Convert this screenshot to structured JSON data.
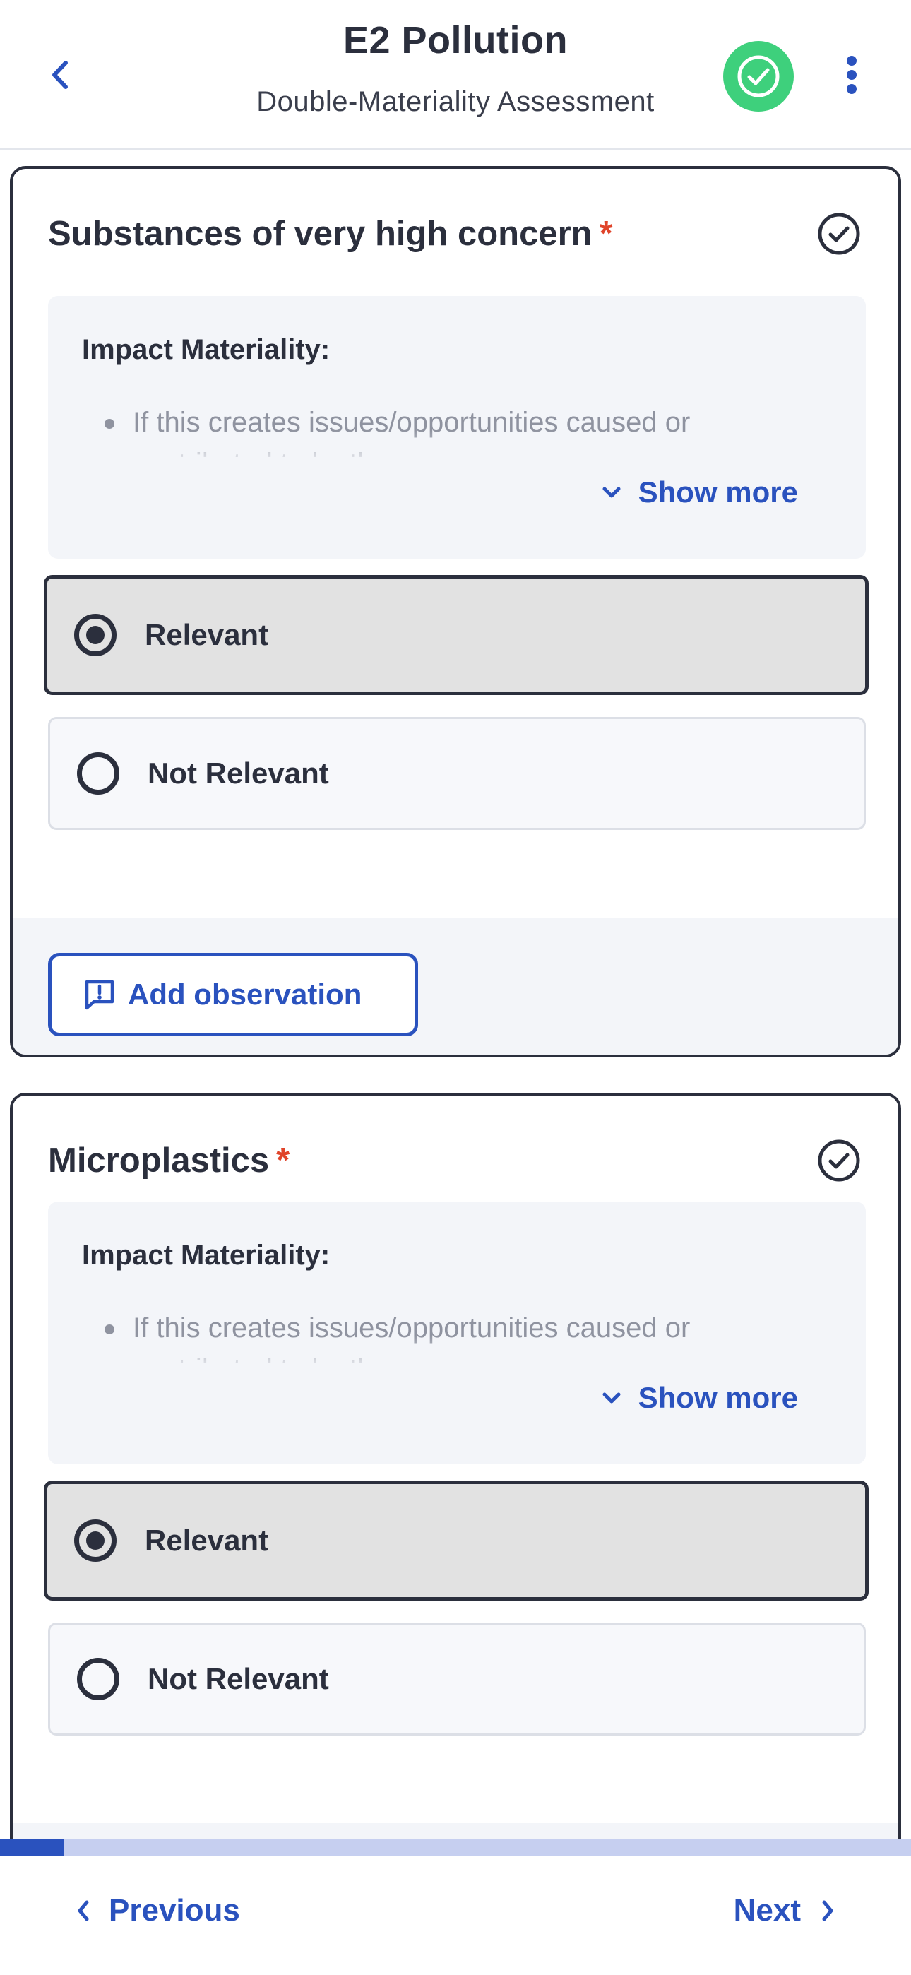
{
  "header": {
    "title": "E2 Pollution",
    "subtitle": "Double-Materiality Assessment"
  },
  "cards": [
    {
      "title": "Substances of very high concern",
      "required_mark": "*",
      "info_heading": "Impact Materiality:",
      "info_text": "If this creates issues/opportunities caused or contributed to by the company, or",
      "show_more": "Show more",
      "options": [
        {
          "label": "Relevant",
          "selected": true
        },
        {
          "label": "Not Relevant",
          "selected": false
        }
      ],
      "observation_button": "Add observation"
    },
    {
      "title": "Microplastics",
      "required_mark": "*",
      "info_heading": "Impact Materiality:",
      "info_text": "If this creates issues/opportunities caused or contributed to by the company, or",
      "show_more": "Show more",
      "options": [
        {
          "label": "Relevant",
          "selected": true
        },
        {
          "label": "Not Relevant",
          "selected": false
        }
      ]
    }
  ],
  "progress_fraction": 0.07,
  "footer": {
    "previous_label": "Previous",
    "next_label": "Next"
  },
  "colors": {
    "accent": "#2a52be",
    "status_green": "#3ed07c",
    "required_red": "#e0442a",
    "dark": "#2b2f3d"
  },
  "icons": {
    "back": "chevron-left-icon",
    "status": "check-circle-icon",
    "more": "more-vertical-icon",
    "card_check": "check-circle-outline-icon",
    "show_more": "chevron-down-icon",
    "observation": "comment-alert-icon",
    "previous": "chevron-left-icon",
    "next": "chevron-right-icon"
  }
}
